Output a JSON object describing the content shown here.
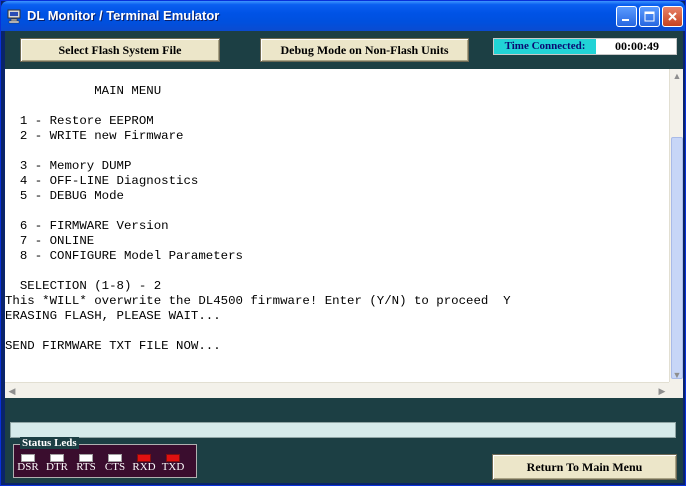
{
  "window": {
    "title": "DL Monitor / Terminal Emulator"
  },
  "toolbar": {
    "select_flash_label": "Select Flash System File",
    "debug_mode_label": "Debug Mode on Non-Flash Units",
    "time_connected_label": "Time Connected:",
    "time_connected_value": "00:00:49"
  },
  "terminal": {
    "lines": [
      "",
      "            MAIN MENU",
      "",
      "  1 - Restore EEPROM",
      "  2 - WRITE new Firmware",
      "",
      "  3 - Memory DUMP",
      "  4 - OFF-LINE Diagnostics",
      "  5 - DEBUG Mode",
      "",
      "  6 - FIRMWARE Version",
      "  7 - ONLINE",
      "  8 - CONFIGURE Model Parameters",
      "",
      "  SELECTION (1-8) - 2",
      "This *WILL* overwrite the DL4500 firmware! Enter (Y/N) to proceed  Y",
      "ERASING FLASH, PLEASE WAIT...",
      "",
      "SEND FIRMWARE TXT FILE NOW..."
    ]
  },
  "status_leds": {
    "title": "Status Leds",
    "leds": [
      {
        "label": "DSR",
        "on": false
      },
      {
        "label": "DTR",
        "on": false
      },
      {
        "label": "RTS",
        "on": false
      },
      {
        "label": "CTS",
        "on": false
      },
      {
        "label": "RXD",
        "on": true
      },
      {
        "label": "TXD",
        "on": true
      }
    ]
  },
  "footer": {
    "return_label": "Return To Main Menu"
  },
  "colors": {
    "titlebar": "#0053e6",
    "band": "#1c3f44",
    "time_label_bg": "#21d3d6",
    "led_on": "#e01010",
    "button_face": "#ece6c9"
  }
}
